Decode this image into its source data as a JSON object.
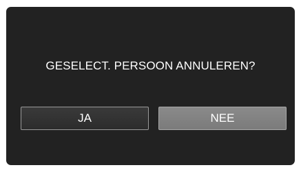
{
  "dialog": {
    "message": "GESELECT. PERSOON ANNULEREN?",
    "yes_label": "JA",
    "no_label": "NEE",
    "selected_button": "NEE"
  },
  "colors": {
    "background": "#222222",
    "text": "#ffffff",
    "button_default": "#333333",
    "button_selected": "#808080"
  }
}
